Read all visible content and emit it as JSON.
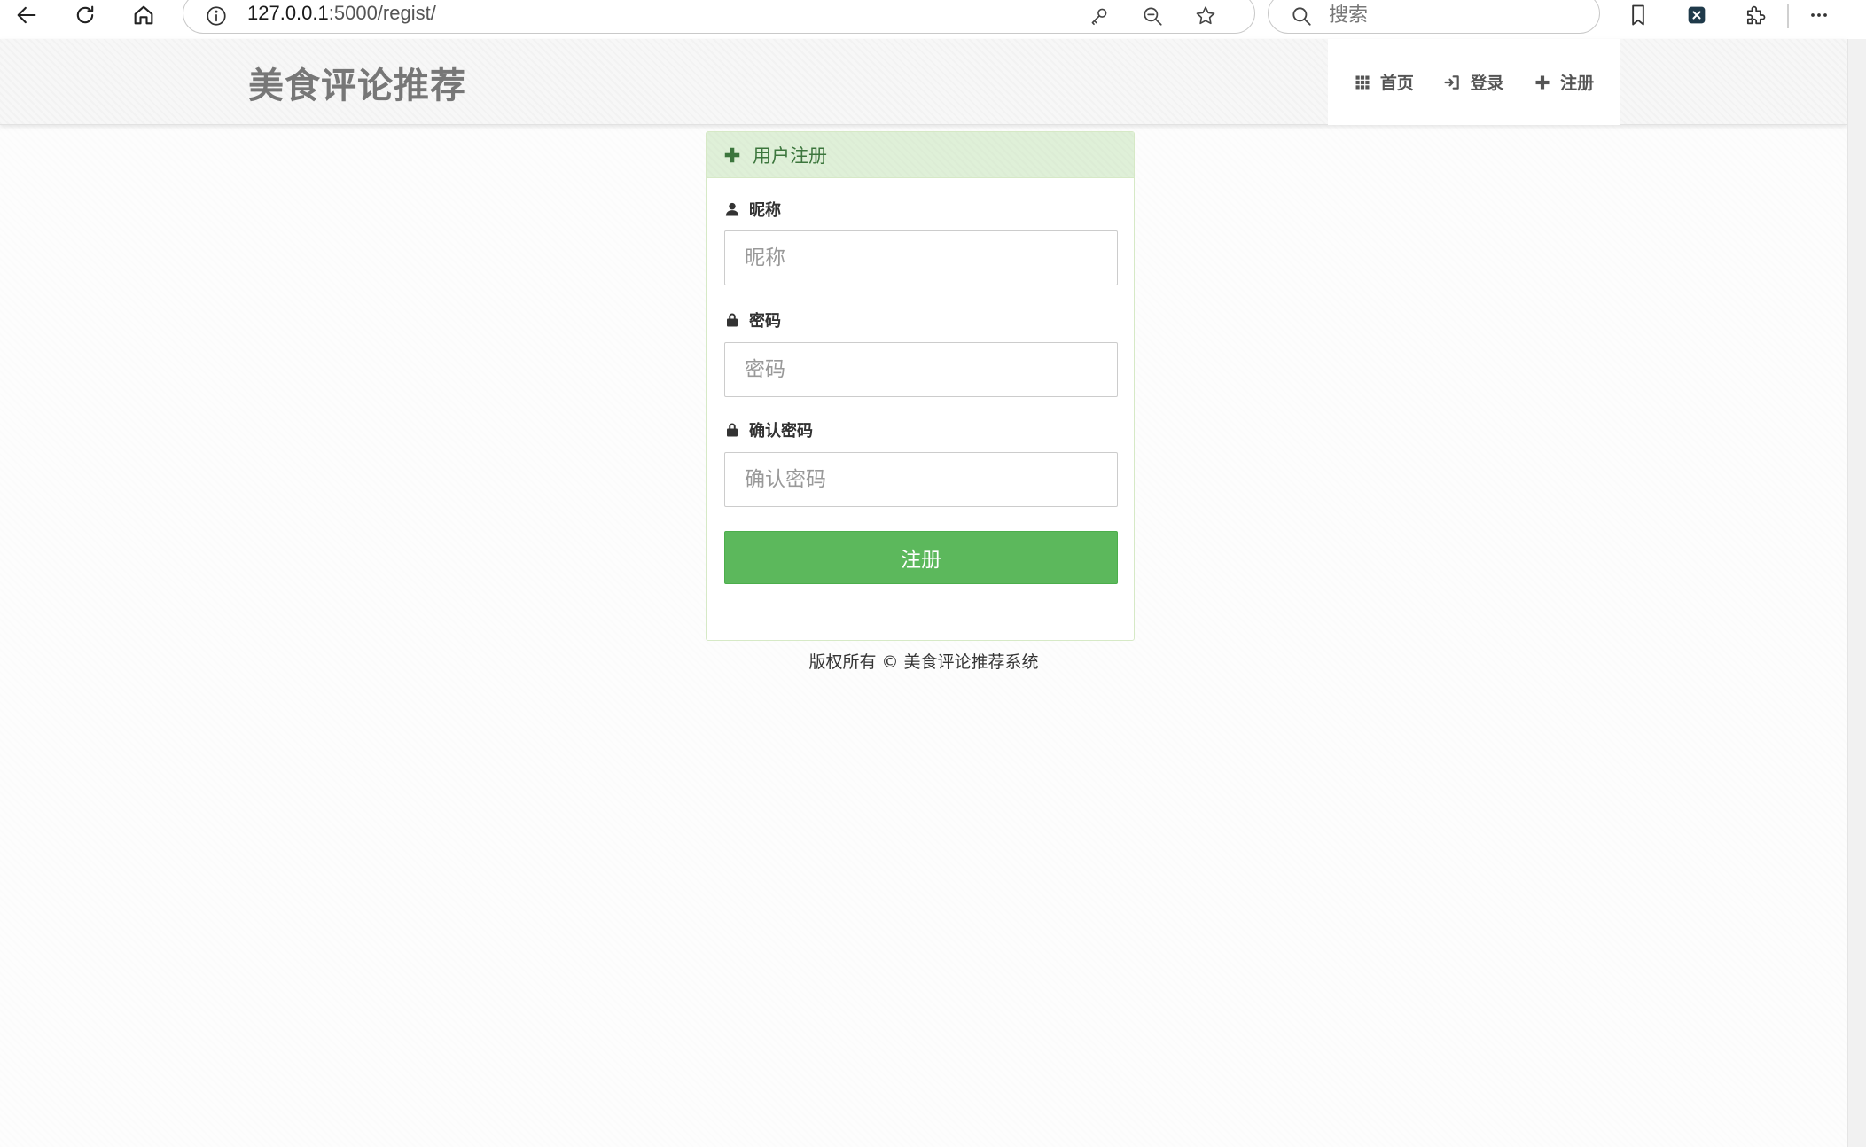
{
  "browser": {
    "url_host": "127.0.0.1",
    "url_path": ":5000/regist/",
    "search_placeholder": "搜索"
  },
  "navbar": {
    "brand": "美食评论推荐",
    "links": [
      {
        "label": "首页",
        "icon": "grid-icon"
      },
      {
        "label": "登录",
        "icon": "login-icon"
      },
      {
        "label": "注册",
        "icon": "plus-icon"
      }
    ]
  },
  "register": {
    "title": "用户注册",
    "title_icon": "plus-icon",
    "fields": [
      {
        "label": "昵称",
        "icon": "user-icon",
        "value": "",
        "placeholder": "昵称"
      },
      {
        "label": "密码",
        "icon": "lock-icon",
        "value": "",
        "placeholder": "密码"
      },
      {
        "label": "确认密码",
        "icon": "lock-icon",
        "value": "",
        "placeholder": "确认密码"
      }
    ],
    "submit_label": "注册"
  },
  "footer": {
    "text": "版权所有 © 美食评论推荐系统"
  },
  "colors": {
    "success_green": "#5cb85c",
    "heading_bg": "#dff0d8",
    "heading_text": "#3c763d",
    "brand_gray": "#777777"
  }
}
